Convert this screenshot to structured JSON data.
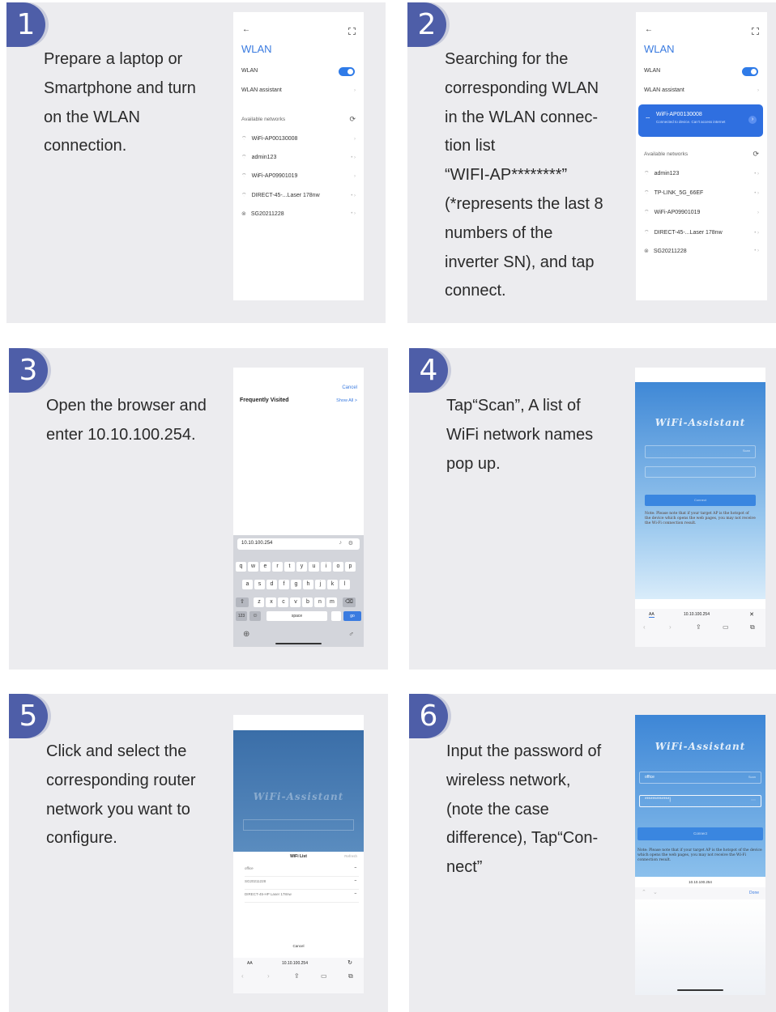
{
  "steps": [
    {
      "number": "1",
      "text": "Prepare a laptop or\nSmartphone and turn\non the WLAN\nconnection."
    },
    {
      "number": "2",
      "text": "Searching for the\ncorresponding WLAN\nin the WLAN connec-\ntion list\n“WIFI-AP********”\n(*represents the last 8\nnumbers of the\ninverter SN), and tap\nconnect."
    },
    {
      "number": "3",
      "text": "Open the browser and\nenter 10.10.100.254."
    },
    {
      "number": "4",
      "text": "Tap“Scan”,  A list of\nWiFi network names\npop up."
    },
    {
      "number": "5",
      "text": "Click and select the\ncorresponding router\nnetwork you want to\nconfigure."
    },
    {
      "number": "6",
      "text": " Input the password of\nwireless network,\n(note the case\ndifference),  Tap“Con-\nnect”"
    }
  ],
  "phone1": {
    "back": "←",
    "title": "WLAN",
    "wlan_label": "WLAN",
    "assistant_label": "WLAN assistant",
    "available": "Available networks",
    "networks": [
      "WiFi-AP00130008",
      "admin123",
      "WiFi-AP09901019",
      "DIRECT-45-...Laser 178nw",
      "SG20211228"
    ]
  },
  "phone2": {
    "back": "←",
    "title": "WLAN",
    "wlan_label": "WLAN",
    "assistant_label": "WLAN assistant",
    "connected_name": "WiFi-AP00130008",
    "connected_sub": "Connected to device. Can't access internet",
    "available": "Available networks",
    "networks": [
      "admin123",
      "TP-LINK_5G_66EF",
      "WiFi-AP09901019",
      "DIRECT-45-...Laser 178nw",
      "SG20211228"
    ]
  },
  "phone3": {
    "cancel": "Cancel",
    "frequently": "Frequently Visited",
    "show_all": "Show All >",
    "url": "10.10.100.254",
    "row1": [
      "q",
      "w",
      "e",
      "r",
      "t",
      "y",
      "u",
      "i",
      "o",
      "p"
    ],
    "row2": [
      "a",
      "s",
      "d",
      "f",
      "g",
      "h",
      "j",
      "k",
      "l"
    ],
    "row3": [
      "z",
      "x",
      "c",
      "v",
      "b",
      "n",
      "m"
    ],
    "key123": "123",
    "space": "space",
    "go": "go"
  },
  "phone4": {
    "app_title": "WiFi-Assistant",
    "scan": "Scan",
    "connect": "Connect",
    "note": "Note: Please note that if your target AP is the hotspot of the device which opens the web pages, you may not receive the Wi-Fi connection result.",
    "aa": "AA",
    "url": "10.10.100.254",
    "close": "✕"
  },
  "phone5": {
    "app_title": "WiFi-Assistant",
    "list_title": "WiFi List",
    "refresh": "Refresh",
    "networks": [
      "office",
      "SG20211228",
      "DIRECT-45-HP Laser 178nw"
    ],
    "cancel": "Cancel",
    "aa": "AA",
    "url": "10.10.100.254"
  },
  "phone6": {
    "app_title": "WiFi-Assistant",
    "ssid": "office",
    "password": "*************|",
    "scan": "Scan",
    "connect": "Connect",
    "note": "Note: Please note that if your target AP is the hotspot of the device which opens the web pages, you may not receive the Wi-Fi connection result.",
    "url": "10.10.100.254",
    "done": "Done"
  }
}
